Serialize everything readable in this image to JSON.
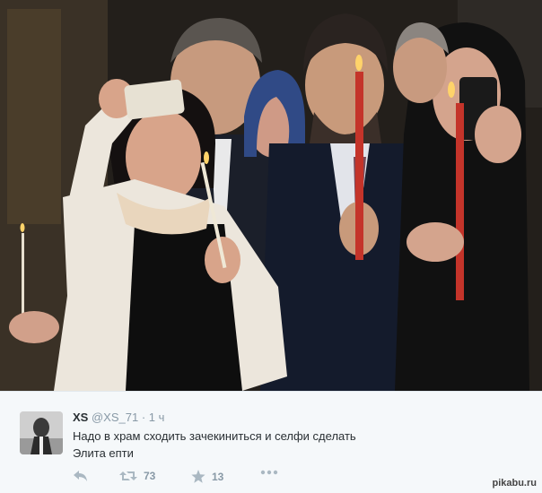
{
  "tweet": {
    "name": "XS",
    "handle": "@XS_71",
    "separator": "·",
    "time": "1 ч",
    "text_line1": "Надо в храм сходить зачекиниться и селфи сделать",
    "text_line2": "Элита епти",
    "actions": {
      "reply_icon": "reply-icon",
      "retweet_icon": "retweet-icon",
      "retweet_count": "73",
      "favorite_icon": "star-icon",
      "favorite_count": "13",
      "more_icon": "more-icon"
    }
  },
  "watermark": "pikabu.ru",
  "colors": {
    "tweet_bg": "#f5f8fa",
    "text": "#292f33",
    "muted": "#8899a6",
    "candle": "#c4342a",
    "flame": "#ffd36a"
  }
}
